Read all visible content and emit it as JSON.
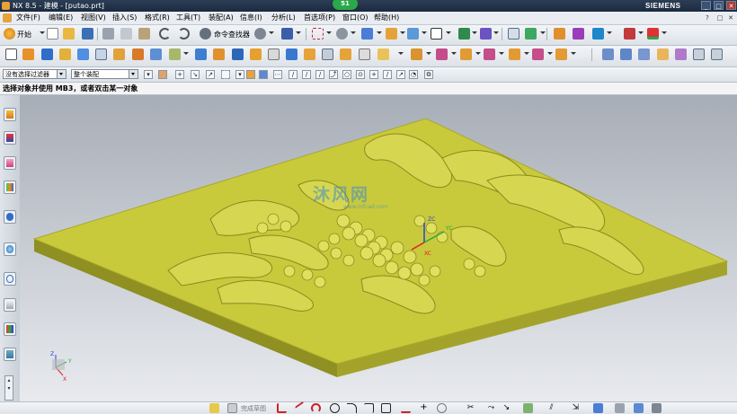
{
  "window": {
    "title": "NX 8.5 - 建模 - [putao.prt]",
    "badge": "51",
    "brand": "SIEMENS",
    "controls": [
      "_",
      "□",
      "✕"
    ]
  },
  "menu": {
    "items": [
      "文件(F)",
      "编辑(E)",
      "视图(V)",
      "插入(S)",
      "格式(R)",
      "工具(T)",
      "装配(A)",
      "信息(I)",
      "分析(L)",
      "首选项(P)",
      "窗口(O)",
      "帮助(H)"
    ],
    "right_controls": [
      "?",
      "□",
      "✕"
    ]
  },
  "toolbar1": {
    "start_label": "开始",
    "command_finder_label": "命令查找器"
  },
  "selection_bar": {
    "filter_value": "没有选择过滤器",
    "scope_value": "整个装配"
  },
  "cue_line": {
    "text": "选择对象并使用 MB3，或者双击某一对象"
  },
  "bottom_bar": {
    "finish_sketch_label": "完成草图"
  },
  "viewport": {
    "watermark": "沐风网",
    "watermark_sub": "www.mfcad.com",
    "triad_labels": {
      "z": "Z",
      "y": "Y",
      "x": "X"
    },
    "wcs_labels": {
      "z": "ZC",
      "y": "YC",
      "x": "XC"
    },
    "colors": {
      "model": "#c9c93c",
      "model_side": "#8f8f22",
      "background_top": "#a7adb6",
      "background_bottom": "#e8eaee"
    }
  },
  "icons": {
    "resource_bar": [
      "assembly-navigator-icon",
      "constraint-navigator-icon",
      "part-navigator-icon",
      "reuse-library-icon",
      "hd3d-tools-icon",
      "web-browser-icon",
      "history-icon",
      "system-materials-icon",
      "process-studio-icon",
      "roles-icon"
    ]
  }
}
